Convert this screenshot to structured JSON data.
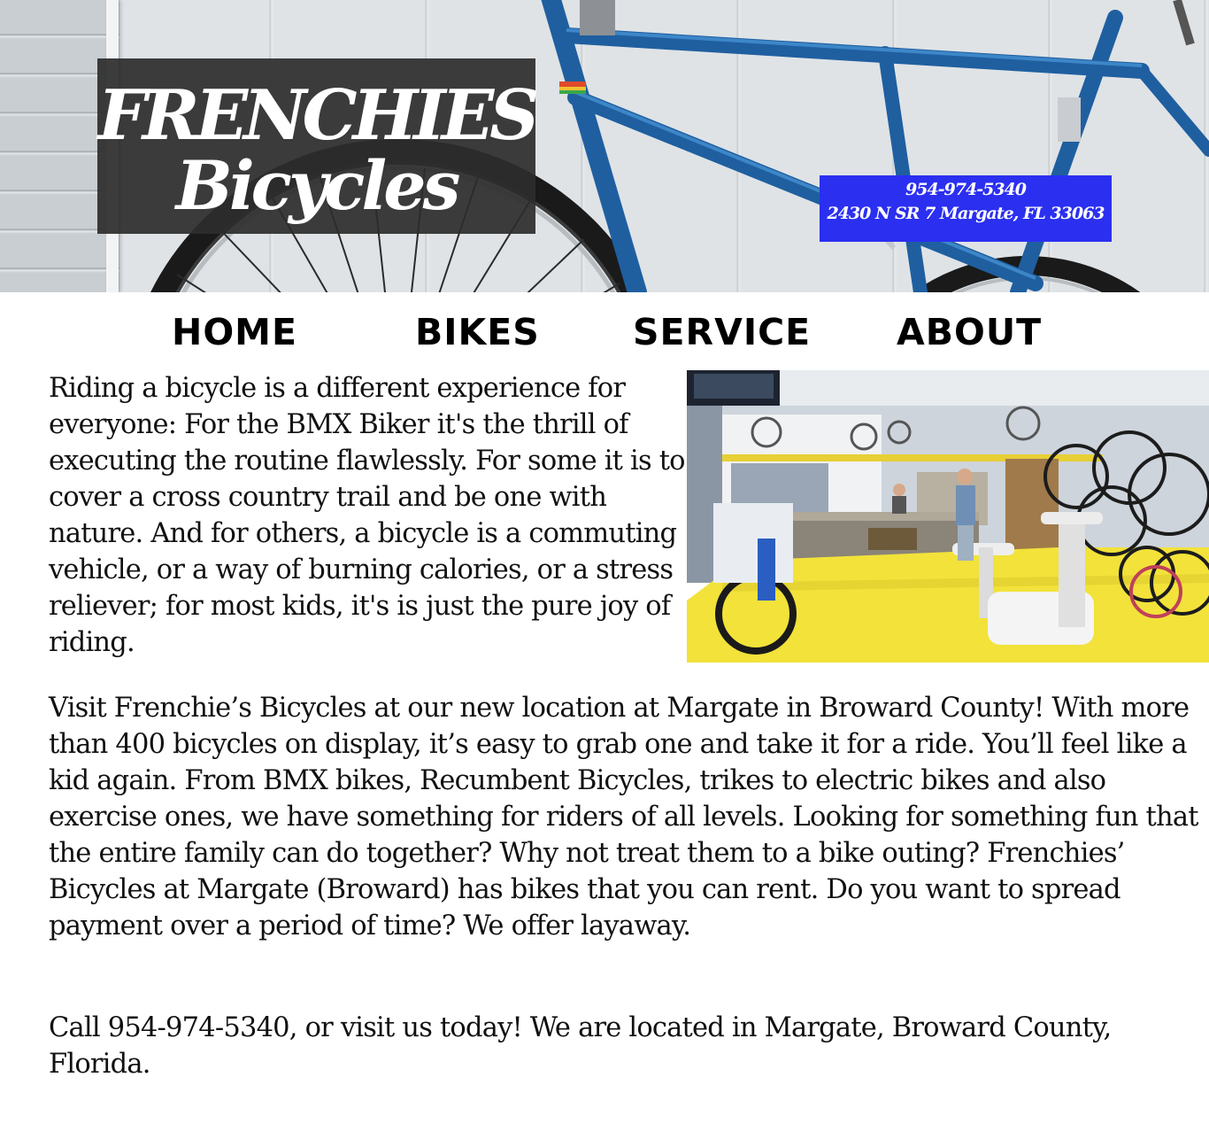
{
  "header": {
    "logo_line1": "FRENCHIES",
    "logo_line2": "Bicycles",
    "phone": "954-974-5340",
    "address": "2430 N SR 7 Margate, FL 33063"
  },
  "nav": {
    "items": [
      {
        "label": "HOME"
      },
      {
        "label": "BIKES"
      },
      {
        "label": "SERVICE"
      },
      {
        "label": "ABOUT"
      }
    ]
  },
  "content": {
    "intro": "Riding a bicycle is a different experience for everyone: For the BMX Biker it's the thrill of executing the routine flawlessly. For some it is to cover a cross country trail and be one with nature. And for others, a bicycle is a commuting vehicle, or a way of burning calories, or a stress reliever; for most kids, it's is just the pure joy of riding.",
    "visit": "Visit Frenchie’s Bicycles at our new location at Margate in Broward County! With more than 400 bicycles on display, it’s easy to grab one and take it for a ride. You’ll feel like a kid again. From BMX bikes, Recumbent Bicycles, trikes to electric bikes and also exercise ones, we have something for riders of all levels. Looking for something fun that the entire family can do together? Why not treat them to a bike outing? Frenchies’ Bicycles at Margate (Broward) has bikes that you can rent. Do you want to spread payment over a period of time? We offer layaway.",
    "call": "Call 954-974-5340, or visit us today! We are located in Margate, Broward County, Florida."
  },
  "colors": {
    "contact_bg": "#2b2ff0",
    "logo_bg": "#2d2d2d",
    "bike_frame": "#1f5fa0",
    "shop_floor": "#f2e23a"
  }
}
